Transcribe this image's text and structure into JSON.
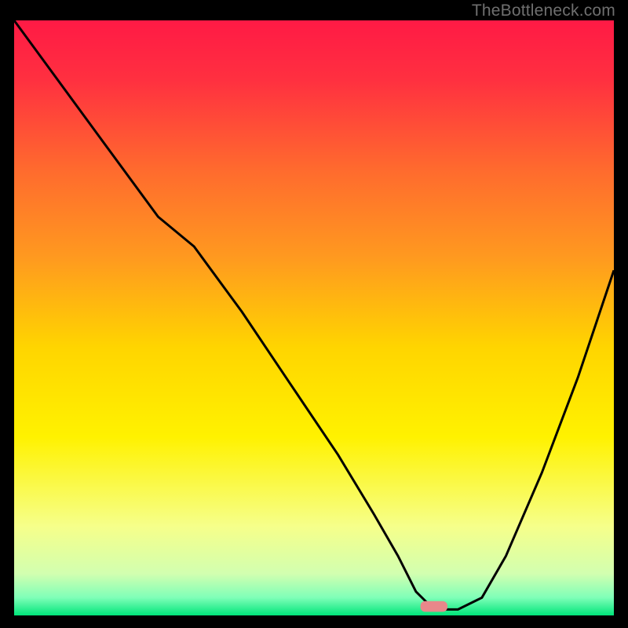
{
  "watermark": "TheBottleneck.com",
  "chart_data": {
    "type": "line",
    "title": "",
    "xlabel": "",
    "ylabel": "",
    "xlim": [
      0,
      100
    ],
    "ylim": [
      0,
      100
    ],
    "grid": false,
    "legend": false,
    "background": {
      "kind": "vertical-gradient",
      "stops": [
        {
          "offset": 0.0,
          "color": "#ff1a45"
        },
        {
          "offset": 0.1,
          "color": "#ff3040"
        },
        {
          "offset": 0.25,
          "color": "#ff6a2e"
        },
        {
          "offset": 0.4,
          "color": "#ff9a1f"
        },
        {
          "offset": 0.55,
          "color": "#ffd500"
        },
        {
          "offset": 0.7,
          "color": "#fff200"
        },
        {
          "offset": 0.85,
          "color": "#f6ff8a"
        },
        {
          "offset": 0.93,
          "color": "#d2ffb0"
        },
        {
          "offset": 0.97,
          "color": "#7fffb8"
        },
        {
          "offset": 1.0,
          "color": "#00e57a"
        }
      ]
    },
    "series": [
      {
        "name": "bottleneck-curve",
        "color": "#000000",
        "x": [
          0,
          8,
          16,
          24,
          30,
          38,
          46,
          54,
          60,
          64,
          67,
          70,
          74,
          78,
          82,
          88,
          94,
          100
        ],
        "y": [
          100,
          89,
          78,
          67,
          62,
          51,
          39,
          27,
          17,
          10,
          4,
          1,
          1,
          3,
          10,
          24,
          40,
          58
        ]
      }
    ],
    "marker": {
      "name": "target-marker",
      "shape": "rounded-rect",
      "color": "#e8878a",
      "x": 70,
      "y": 1.5,
      "width_frac": 0.045,
      "height_frac": 0.018
    }
  }
}
